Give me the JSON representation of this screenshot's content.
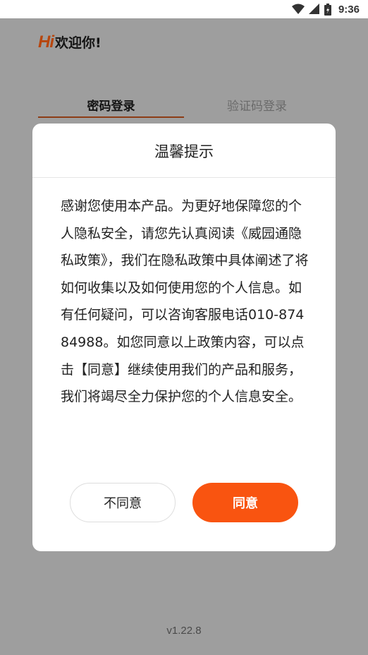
{
  "status_bar": {
    "time": "9:36",
    "icons": [
      "wifi-icon",
      "cellular-signal-icon",
      "battery-icon"
    ]
  },
  "header": {
    "hi": "Hi",
    "welcome": "欢迎你!"
  },
  "tabs": [
    {
      "label": "密码登录",
      "active": true
    },
    {
      "label": "验证码登录",
      "active": false
    }
  ],
  "dialog": {
    "title": "温馨提示",
    "body": "感谢您使用本产品。为更好地保障您的个人隐私安全，请您先认真阅读《威园通隐私政策》，我们在隐私政策中具体阐述了将如何收集以及如何使用您的个人信息。如有任何疑问，可以咨询客服电话010-87484988。如您同意以上政策内容，可以点击【同意】继续使用我们的产品和服务，我们将竭尽全力保护您的个人信息安全。",
    "disagree_label": "不同意",
    "agree_label": "同意"
  },
  "footer": {
    "version": "v1.22.8"
  },
  "colors": {
    "accent": "#f95410",
    "brand": "#b7460e",
    "overlay_background": "#9e9e9e"
  }
}
